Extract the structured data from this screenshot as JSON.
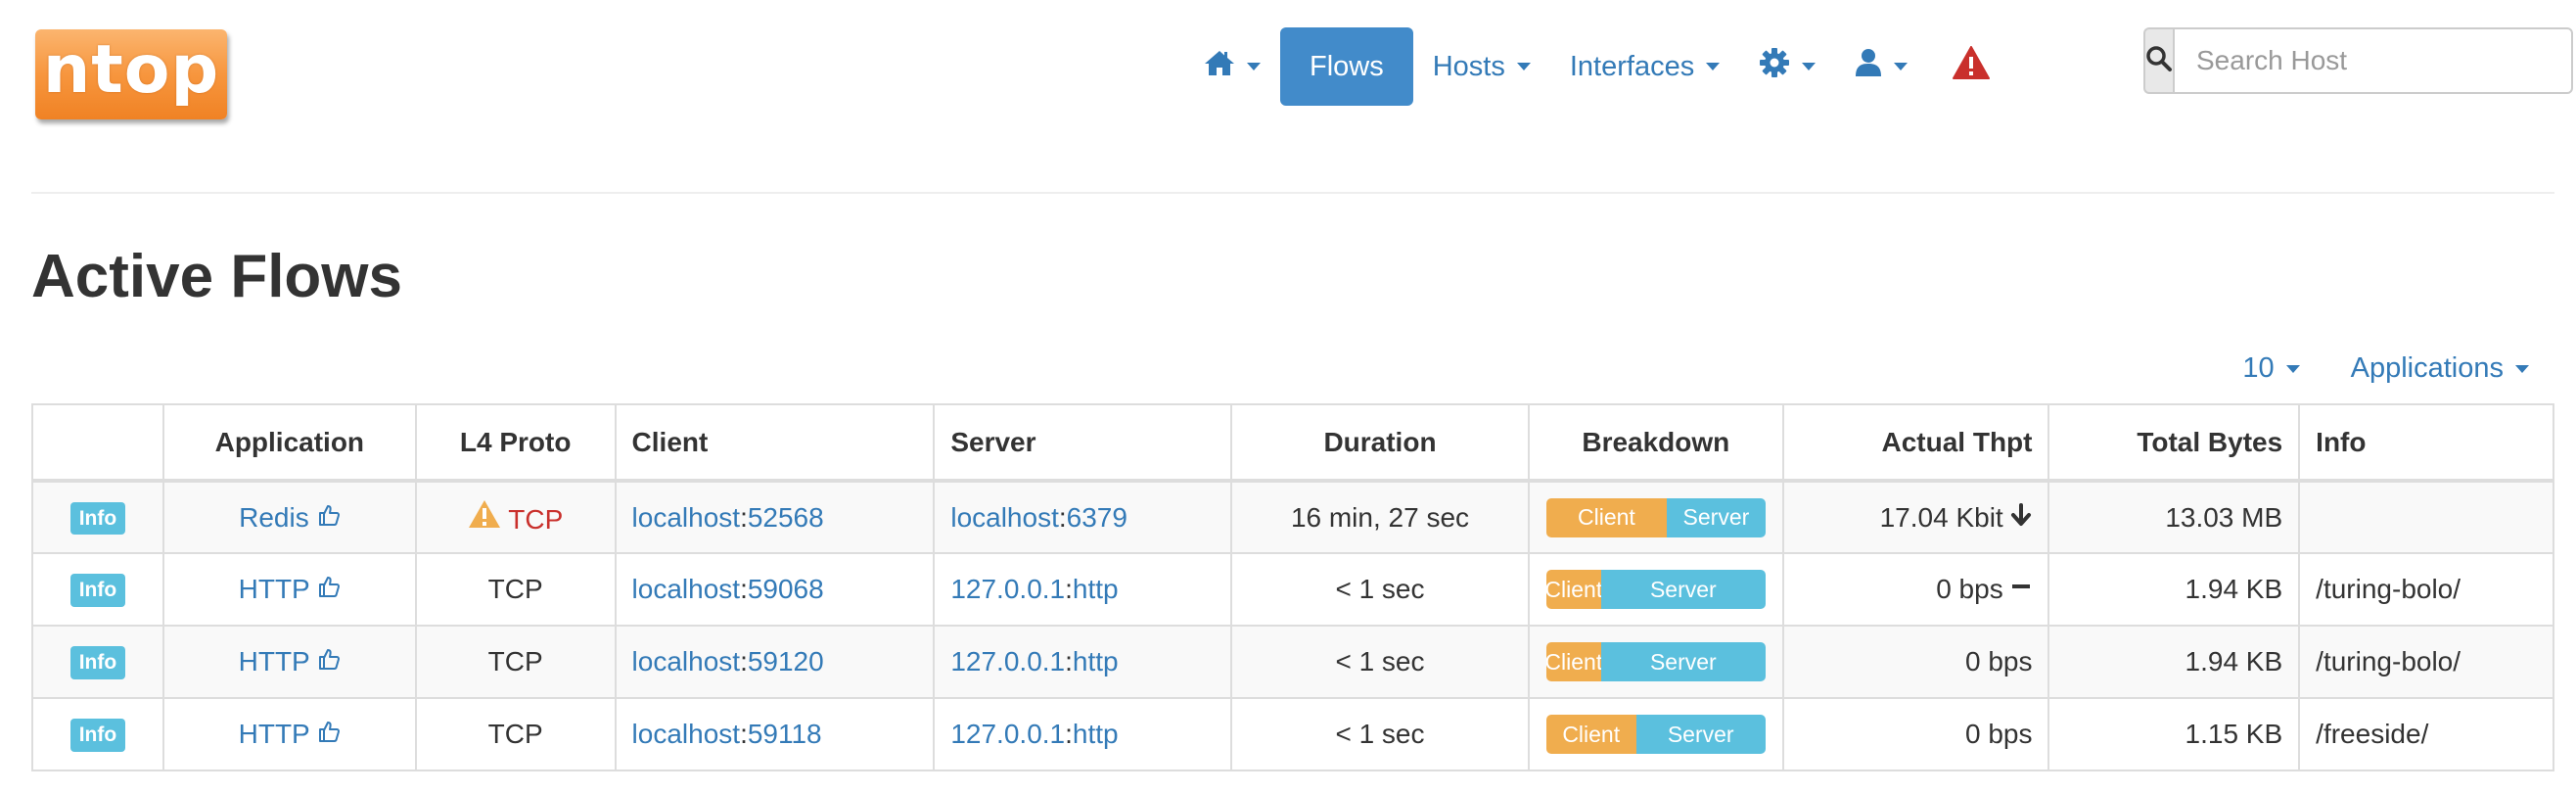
{
  "logo": {
    "text": "ntop"
  },
  "nav": {
    "flows_label": "Flows",
    "hosts_label": "Hosts",
    "interfaces_label": "Interfaces"
  },
  "search": {
    "placeholder": "Search Host"
  },
  "page": {
    "title": "Active Flows"
  },
  "table_tools": {
    "rows_per_page": "10",
    "filter_label": "Applications"
  },
  "table": {
    "headers": [
      "",
      "Application",
      "L4 Proto",
      "Client",
      "Server",
      "Duration",
      "Breakdown",
      "Actual Thpt",
      "Total Bytes",
      "Info"
    ],
    "rows": [
      {
        "info_label": "Info",
        "application": "Redis",
        "l4proto": "TCP",
        "client_host": "localhost",
        "client_port": "52568",
        "server_host": "localhost",
        "server_port": "6379",
        "duration": "16 min, 27 sec",
        "breakdown_client_label": "Client",
        "breakdown_server_label": "Server",
        "breakdown_client_fraction": 0.55,
        "thpt": "17.04 Kbit",
        "total_bytes": "13.03 MB",
        "info": ""
      },
      {
        "info_label": "Info",
        "application": "HTTP",
        "l4proto": "TCP",
        "client_host": "localhost",
        "client_port": "59068",
        "server_host": "127.0.0.1",
        "server_port": "http",
        "duration": "< 1 sec",
        "breakdown_client_label": "Client",
        "breakdown_server_label": "Server",
        "breakdown_client_fraction": 0.25,
        "thpt": "0 bps",
        "total_bytes": "1.94 KB",
        "info": "/turing-bolo/"
      },
      {
        "info_label": "Info",
        "application": "HTTP",
        "l4proto": "TCP",
        "client_host": "localhost",
        "client_port": "59120",
        "server_host": "127.0.0.1",
        "server_port": "http",
        "duration": "< 1 sec",
        "breakdown_client_label": "Client",
        "breakdown_server_label": "Server",
        "breakdown_client_fraction": 0.25,
        "thpt": "0 bps",
        "total_bytes": "1.94 KB",
        "info": "/turing-bolo/"
      },
      {
        "info_label": "Info",
        "application": "HTTP",
        "l4proto": "TCP",
        "client_host": "localhost",
        "client_port": "59118",
        "server_host": "127.0.0.1",
        "server_port": "http",
        "duration": "< 1 sec",
        "breakdown_client_label": "Client",
        "breakdown_server_label": "Server",
        "breakdown_client_fraction": 0.41,
        "thpt": "0 bps",
        "total_bytes": "1.15 KB",
        "info": "/freeside/"
      }
    ]
  },
  "colors": {
    "link": "#337ab7",
    "active_nav": "#428bca",
    "client_bar": "#f0ad4e",
    "server_bar": "#5bc0de",
    "warning": "#c9302c",
    "info_label": "#5bc0de",
    "logo_orange": "#f7963e"
  },
  "icons": {
    "home": "home-icon",
    "settings": "gear-icon",
    "user": "user-icon",
    "alerts": "warning-triangle-icon",
    "search": "search-icon",
    "thumbs_up": "thumbs-up-icon",
    "thpt_down": "arrow-down-icon",
    "thpt_stable": "minus-icon",
    "proto_warning": "warning-icon"
  }
}
